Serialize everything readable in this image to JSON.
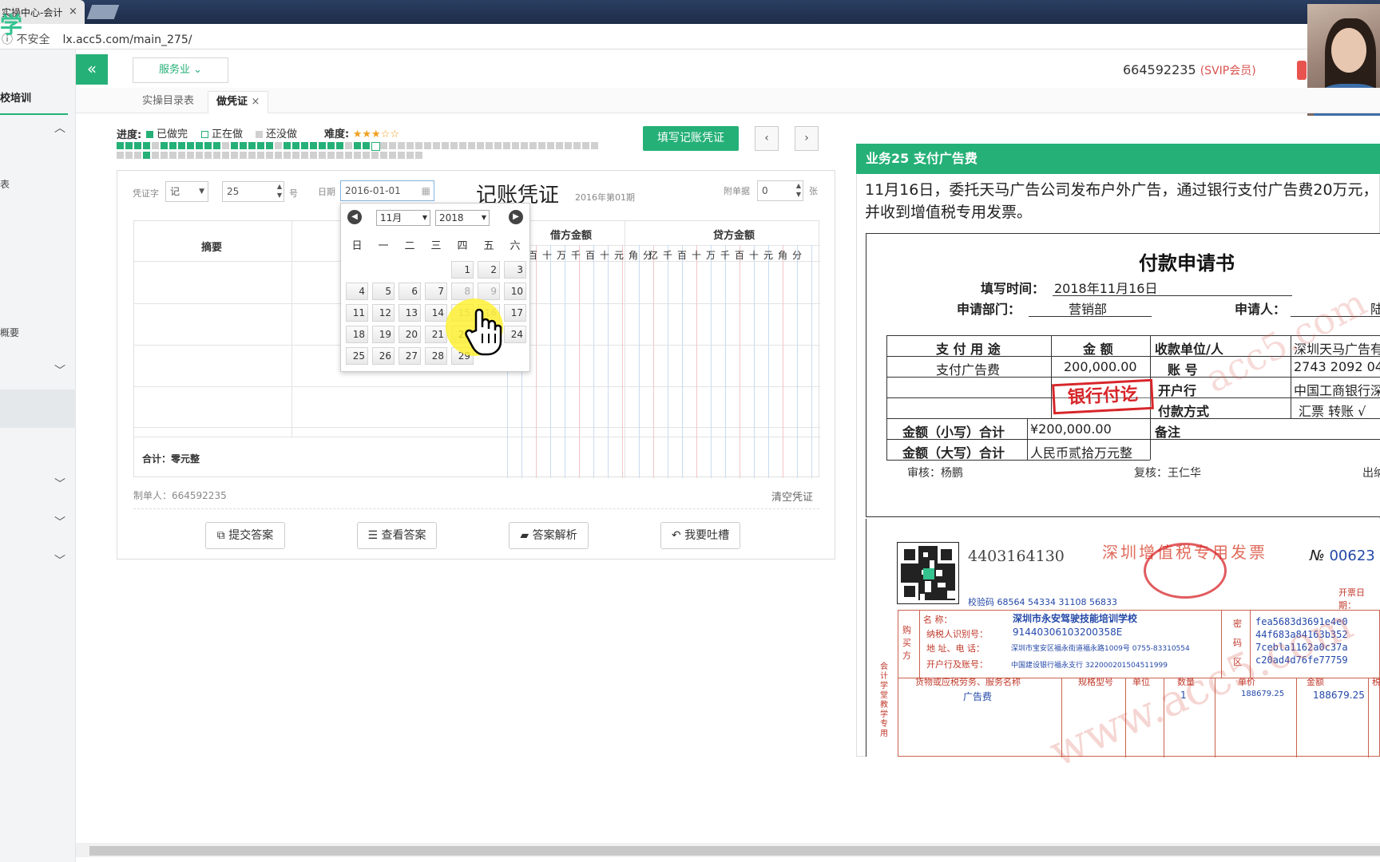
{
  "browser": {
    "tab_title": "实操中心-会计",
    "tab_close": "×",
    "insecure_label": "ⓘ 不安全",
    "url": "lx.acc5.com/main_275/"
  },
  "logo_text": "学",
  "header": {
    "collapse_icon": "«",
    "biz_dropdown": "服务业 ⌄",
    "account_id": "664592235",
    "account_level": "(SVIP会员)"
  },
  "sidebar": {
    "title": "校培训",
    "item_a": "表",
    "item_b": "概要"
  },
  "subtabs": [
    {
      "label": "实操目录表"
    },
    {
      "label": "做凭证"
    }
  ],
  "subtab_close": "×",
  "progress": {
    "label": "进度:",
    "done_label": "已做完",
    "doing_label": "正在做",
    "todo_label": "还没做",
    "difficulty_label": "难度:",
    "difficulty_stars": "★★★☆☆",
    "colors": {
      "done": "#25b077",
      "doing": "#ffffff",
      "todo": "#d0d0d0"
    }
  },
  "toolbar": {
    "fill_voucher": "填写记账凭证",
    "prev": "‹",
    "next": "›"
  },
  "voucher": {
    "word_label": "凭证字",
    "word_value": "记",
    "number_value": "25",
    "number_suffix": "号",
    "date_label": "日期",
    "date_value": "2016-01-01",
    "title": "记账凭证",
    "period": "2016年第01期",
    "attach_label": "附单据",
    "attach_value": "0",
    "attach_suffix": "张",
    "col_summary": "摘要",
    "col_debit": "借方金额",
    "col_credit": "贷方金额",
    "digit_units": [
      "亿",
      "千",
      "百",
      "十",
      "万",
      "千",
      "百",
      "十",
      "元",
      "角",
      "分"
    ],
    "debit_units_visible": [
      "百",
      "十",
      "万",
      "千",
      "百",
      "十",
      "元",
      "角",
      "分"
    ],
    "total_label": "合计：零元整",
    "maker": "制单人：664592235",
    "clear": "清空凭证"
  },
  "actions": [
    {
      "label": "提交答案",
      "icon": "external-link-icon",
      "glyph": "⧉"
    },
    {
      "label": "查看答案",
      "icon": "database-icon",
      "glyph": "☰"
    },
    {
      "label": "答案解析",
      "icon": "folder-open-icon",
      "glyph": "▰"
    },
    {
      "label": "我要吐槽",
      "icon": "reply-icon",
      "glyph": "↶"
    }
  ],
  "calendar": {
    "month": "11月",
    "year": "2018",
    "weekdays": [
      "日",
      "一",
      "二",
      "三",
      "四",
      "五",
      "六"
    ],
    "rows": [
      [
        "",
        "",
        "",
        "",
        "1",
        "2",
        "3"
      ],
      [
        "4",
        "5",
        "6",
        "7",
        "8",
        "9",
        "10"
      ],
      [
        "11",
        "12",
        "13",
        "14",
        "15",
        "16",
        "17"
      ],
      [
        "18",
        "19",
        "20",
        "21",
        "22",
        "23",
        "24"
      ],
      [
        "25",
        "26",
        "27",
        "28",
        "29",
        "",
        ""
      ]
    ],
    "dim_days": [
      "8",
      "9",
      "15",
      "16"
    ]
  },
  "task": {
    "header": "业务25 支付广告费",
    "description": "11月16日，委托天马广告公司发布户外广告，通过银行支付广告费20万元，并收到增值税专用发票。"
  },
  "payment_form": {
    "title": "付款申请书",
    "fill_time_label": "填写时间：",
    "fill_time_value": "2018年11月16日",
    "dept_label": "申请部门：",
    "dept_value": "营销部",
    "applicant_label": "申请人：",
    "applicant_value": "陆",
    "purpose_label": "支 付 用 途",
    "amount_label": "金  额",
    "payee_label": "收款单位/人",
    "payee_value": "深圳天马广告有",
    "purpose_value": "支付广告费",
    "amount_value": "200,000.00",
    "account_label": "账  号",
    "account_value": "2743 2092 04",
    "bank_label": "开户行",
    "bank_value": "中国工商银行深",
    "method_label": "付款方式",
    "method_value": "汇票  转账 √",
    "small_total_label": "金额（小写）合计",
    "small_total_value": "¥200,000.00",
    "remark_label": "备注",
    "big_total_label": "金额（大写）合计",
    "big_total_value": "人民币贰拾万元整",
    "review": "审核：杨鹏",
    "recheck": "复核：王仁华",
    "cashier": "出纳",
    "stamp": "银行付讫"
  },
  "invoice": {
    "code": "4403164130",
    "title": "深圳增值税专用发票",
    "no_label": "№",
    "no_value": "00623",
    "check_code": "校验码 68564 54334 31108 56833",
    "date_label": "开票日期：",
    "buyer_side": "购买方",
    "buyer_name_label": "名      称：",
    "buyer_name": "深圳市永安驾驶技能培训学校",
    "taxid_label": "纳税人识别号：",
    "taxid": "91440306103200358E",
    "addr_label": "地  址、电  话：",
    "addr": "深圳市宝安区福永街道福永路1009号 0755-83310554",
    "bank_label": "开户行及账号：",
    "bank": "中国建设银行福永支行 322000201504511999",
    "secret_side": "密码区",
    "cipher": [
      "fea5683d3691e4e0",
      "44f683a84163b352",
      "7cebla1162a0c37a",
      "c20ad4d76fe77759"
    ],
    "col_goods": "货物或应税劳务、服务名称",
    "col_spec": "规格型号",
    "col_unit": "单位",
    "col_qty": "数量",
    "col_price": "单价",
    "col_amount": "金额",
    "col_tax": "税",
    "item_name": "广告费",
    "item_qty": "1",
    "item_price": "188679.25",
    "item_amount": "188679.25",
    "side_text": "会计学堂教学专用"
  },
  "watermark": "www.acc5.com",
  "watermark2": "acc5.com"
}
